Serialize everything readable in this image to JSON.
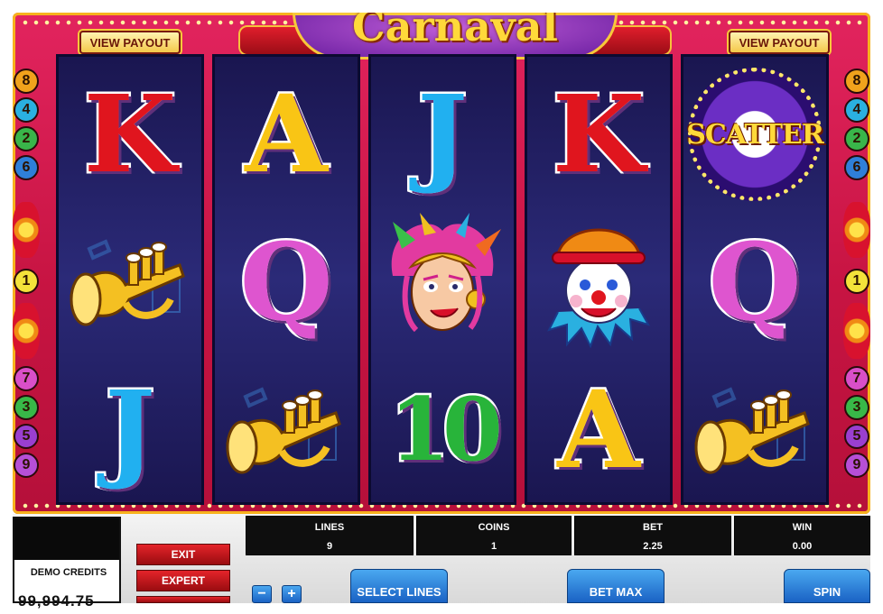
{
  "game": {
    "title": "Carnaval",
    "view_payout_left": "VIEW PAYOUT",
    "view_payout_right": "VIEW PAYOUT",
    "left_line_numbers": [
      "8",
      "4",
      "2",
      "6",
      "1",
      "7",
      "3",
      "5",
      "9"
    ],
    "right_line_numbers": [
      "8",
      "4",
      "2",
      "6",
      "1",
      "7",
      "3",
      "5",
      "9"
    ],
    "reels": [
      [
        {
          "symbol": "K"
        },
        {
          "symbol": "trumpet",
          "icon": "trumpet-icon"
        },
        {
          "symbol": "J"
        }
      ],
      [
        {
          "symbol": "A"
        },
        {
          "symbol": "Q"
        },
        {
          "symbol": "trumpet",
          "icon": "trumpet-icon"
        }
      ],
      [
        {
          "symbol": "J"
        },
        {
          "symbol": "showgirl",
          "icon": "carnival-dancer-icon"
        },
        {
          "symbol": "10"
        }
      ],
      [
        {
          "symbol": "K"
        },
        {
          "symbol": "clown",
          "icon": "clown-icon"
        },
        {
          "symbol": "A"
        }
      ],
      [
        {
          "symbol": "SCATTER"
        },
        {
          "symbol": "Q"
        },
        {
          "symbol": "trumpet",
          "icon": "trumpet-icon"
        }
      ]
    ]
  },
  "panel": {
    "credits_label": "DEMO CREDITS",
    "credits_value": "99,994.75",
    "exit_label": "EXIT",
    "expert_label": "EXPERT",
    "lines_label": "LINES",
    "lines_value": "9",
    "coins_label": "COINS",
    "coins_value": "1",
    "bet_label": "BET",
    "bet_value": "2.25",
    "win_label": "WIN",
    "win_value": "0.00",
    "minus_label": "−",
    "plus_label": "+",
    "select_lines_label": "SELECT LINES",
    "bet_max_label": "BET MAX",
    "spin_label": "SPIN"
  },
  "colors": {
    "frame": "#d81a4e",
    "reel_bg": "#22206a",
    "panel_button": "#2a7ad8",
    "red_button": "#c8161c"
  }
}
